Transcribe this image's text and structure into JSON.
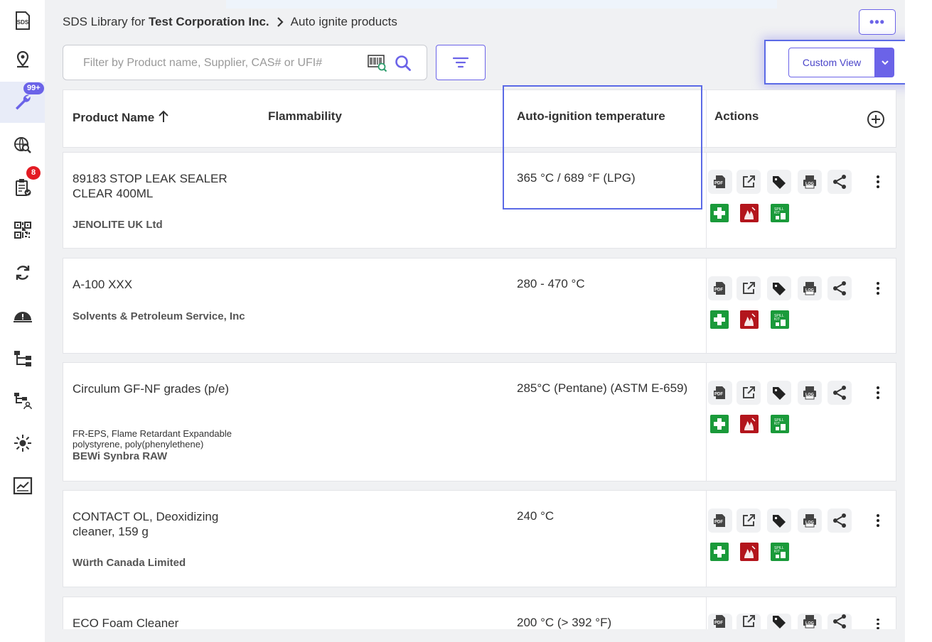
{
  "sidebar": {
    "items": [
      {
        "icon": "sds-icon",
        "label": "SDS"
      },
      {
        "icon": "location-pin-icon"
      },
      {
        "icon": "wrench-icon",
        "badge": "99+",
        "active": true
      },
      {
        "icon": "globe-search-icon"
      },
      {
        "icon": "clipboard-check-icon",
        "badge": "8"
      },
      {
        "icon": "qr-code-icon"
      },
      {
        "icon": "sync-icon"
      },
      {
        "icon": "hazard-dome-icon"
      },
      {
        "icon": "hierarchy-icon"
      },
      {
        "icon": "hierarchy-user-icon"
      },
      {
        "icon": "sun-icon"
      },
      {
        "icon": "report-chart-icon"
      }
    ]
  },
  "breadcrumb": {
    "prefix": "SDS Library for",
    "org": "Test Corporation Inc.",
    "current": "Auto ignite products"
  },
  "toolbar": {
    "more_label": "•••",
    "search_placeholder": "Filter by Product name, Supplier, CAS# or UFI#",
    "custom_view_label": "Custom View"
  },
  "table": {
    "headers": {
      "product_name": "Product Name",
      "flammability": "Flammability",
      "auto_ignition": "Auto-ignition temperature",
      "actions": "Actions"
    },
    "rows": [
      {
        "name": "89183 STOP LEAK SEALER CLEAR 400ML",
        "extra": "",
        "supplier": "JENOLITE UK Ltd",
        "ait": "365 °C / 689 °F (LPG)"
      },
      {
        "name": "A-100 XXX",
        "extra": "",
        "supplier": "Solvents & Petroleum Service, Inc",
        "ait": "280 - 470 °C"
      },
      {
        "name": "Circulum GF-NF grades (p/e)",
        "extra": "FR-EPS, Flame Retardant Expandable polystyrene, poly(phenylethene)",
        "supplier": "BEWi Synbra RAW",
        "ait": "285°C (Pentane) (ASTM E-659)"
      },
      {
        "name": "CONTACT OL, Deoxidizing cleaner, 159 g",
        "extra": "",
        "supplier": "Würth Canada Limited",
        "ait": "240 °C"
      },
      {
        "name": "ECO Foam Cleaner",
        "extra": "",
        "supplier": "",
        "ait": "200 °C (> 392 °F)"
      }
    ],
    "action_icons": [
      "pdf-icon",
      "external-link-icon",
      "tag-icon",
      "log-icon",
      "share-icon"
    ],
    "safety_icons": [
      "first-aid-icon",
      "fire-equipment-icon",
      "spill-kit-icon"
    ],
    "safety_spill_text": "SPILL KIT",
    "pdf_text": "PDF",
    "log_text": "LOG"
  },
  "colors": {
    "accent": "#6b63e8",
    "highlight": "#5b6ae6",
    "first_aid": "#1a9a3a",
    "fire": "#b3151c",
    "spill": "#1a9a3a",
    "badge_red": "#e31b23"
  }
}
